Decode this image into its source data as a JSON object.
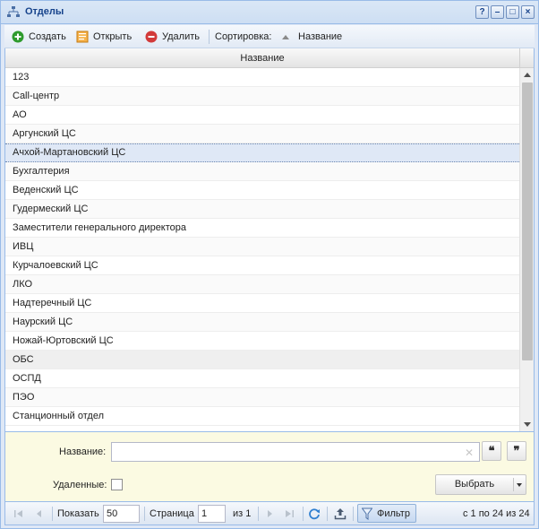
{
  "window": {
    "title": "Отделы",
    "tools": [
      "?",
      "–",
      "□",
      "×"
    ]
  },
  "toolbar": {
    "create_label": "Создать",
    "open_label": "Открыть",
    "delete_label": "Удалить",
    "sort_label": "Сортировка:",
    "sort_field_label": "Название"
  },
  "grid": {
    "column_header": "Название",
    "rows": [
      "123",
      "Call-центр",
      "АО",
      "Аргунский ЦС",
      "Ачхой-Мартановский ЦС",
      "Бухгалтерия",
      "Веденский ЦС",
      "Гудермеский ЦС",
      "Заместители генерального директора",
      "ИВЦ",
      "Курчалоевский ЦС",
      "ЛКО",
      "Надтеречный ЦС",
      "Наурский ЦС",
      "Ножай-Юртовский ЦС",
      "ОБС",
      "ОСПД",
      "ПЭО",
      "Станционный отдел"
    ],
    "selected_index": 4,
    "hover_index": 15
  },
  "filter": {
    "name_label": "Название:",
    "name_value": "",
    "open_quote": "❝",
    "close_quote": "❞",
    "deleted_label": "Удаленные:",
    "deleted_checked": false,
    "select_button_label": "Выбрать"
  },
  "paging": {
    "show_label": "Показать",
    "page_size": "50",
    "page_label": "Страница",
    "page_value": "1",
    "of_label": "из 1",
    "filter_button_label": "Фильтр",
    "summary": "с 1 по 24 из 24"
  },
  "colors": {
    "title_text": "#15428b",
    "create_icon": "#2e9b2e",
    "delete_icon": "#d23a3a",
    "filter_panel_bg": "#fbfae2"
  }
}
